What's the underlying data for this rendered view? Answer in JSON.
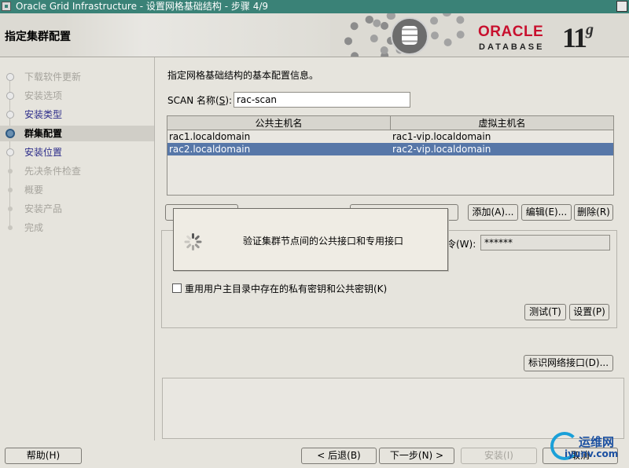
{
  "window": {
    "title": "Oracle Grid Infrastructure - 设置网格基础结构 - 步骤 4/9"
  },
  "header": {
    "page_title": "指定集群配置",
    "logo_oracle": "ORACLE",
    "logo_database": "DATABASE",
    "logo_version": "11",
    "logo_version_suffix": "g"
  },
  "steps": [
    {
      "label": "下载软件更新",
      "state": "done"
    },
    {
      "label": "安装选项",
      "state": "done"
    },
    {
      "label": "安装类型",
      "state": "link"
    },
    {
      "label": "群集配置",
      "state": "current"
    },
    {
      "label": "安装位置",
      "state": "link"
    },
    {
      "label": "先决条件检查",
      "state": "pending"
    },
    {
      "label": "概要",
      "state": "pending"
    },
    {
      "label": "安装产品",
      "state": "pending"
    },
    {
      "label": "完成",
      "state": "pending"
    }
  ],
  "main": {
    "description": "指定网格基础结构的基本配置信息。",
    "scan_label": "SCAN 名称",
    "scan_mnemonic": "S",
    "scan_value": "rac-scan",
    "table": {
      "headers": [
        "公共主机名",
        "虚拟主机名"
      ],
      "rows": [
        {
          "public": "rac1.localdomain",
          "virtual": "rac1-vip.localdomain",
          "selected": false
        },
        {
          "public": "rac2.localdomain",
          "virtual": "rac2-vip.localdomain",
          "selected": true
        }
      ]
    },
    "buttons": {
      "add": "添加(A)...",
      "edit": "编辑(E)...",
      "remove": "删除(R)",
      "test": "测试(T)",
      "setup": "设置(P)",
      "identify_interfaces": "标识网络接口(D)..."
    },
    "password_label": "令(W):",
    "password_value": "******",
    "reuse_keys_label": "重用用户主目录中存在的私有密钥和公共密钥(K)",
    "reuse_keys_checked": false
  },
  "dialog": {
    "message": "验证集群节点间的公共接口和专用接口"
  },
  "footer": {
    "help": "帮助(H)",
    "back": "< 后退(B)",
    "next": "下一步(N) >",
    "install": "安装(I)",
    "cancel": "取消"
  },
  "watermark": {
    "line1": "运维网",
    "line2": "iyunv.com"
  }
}
